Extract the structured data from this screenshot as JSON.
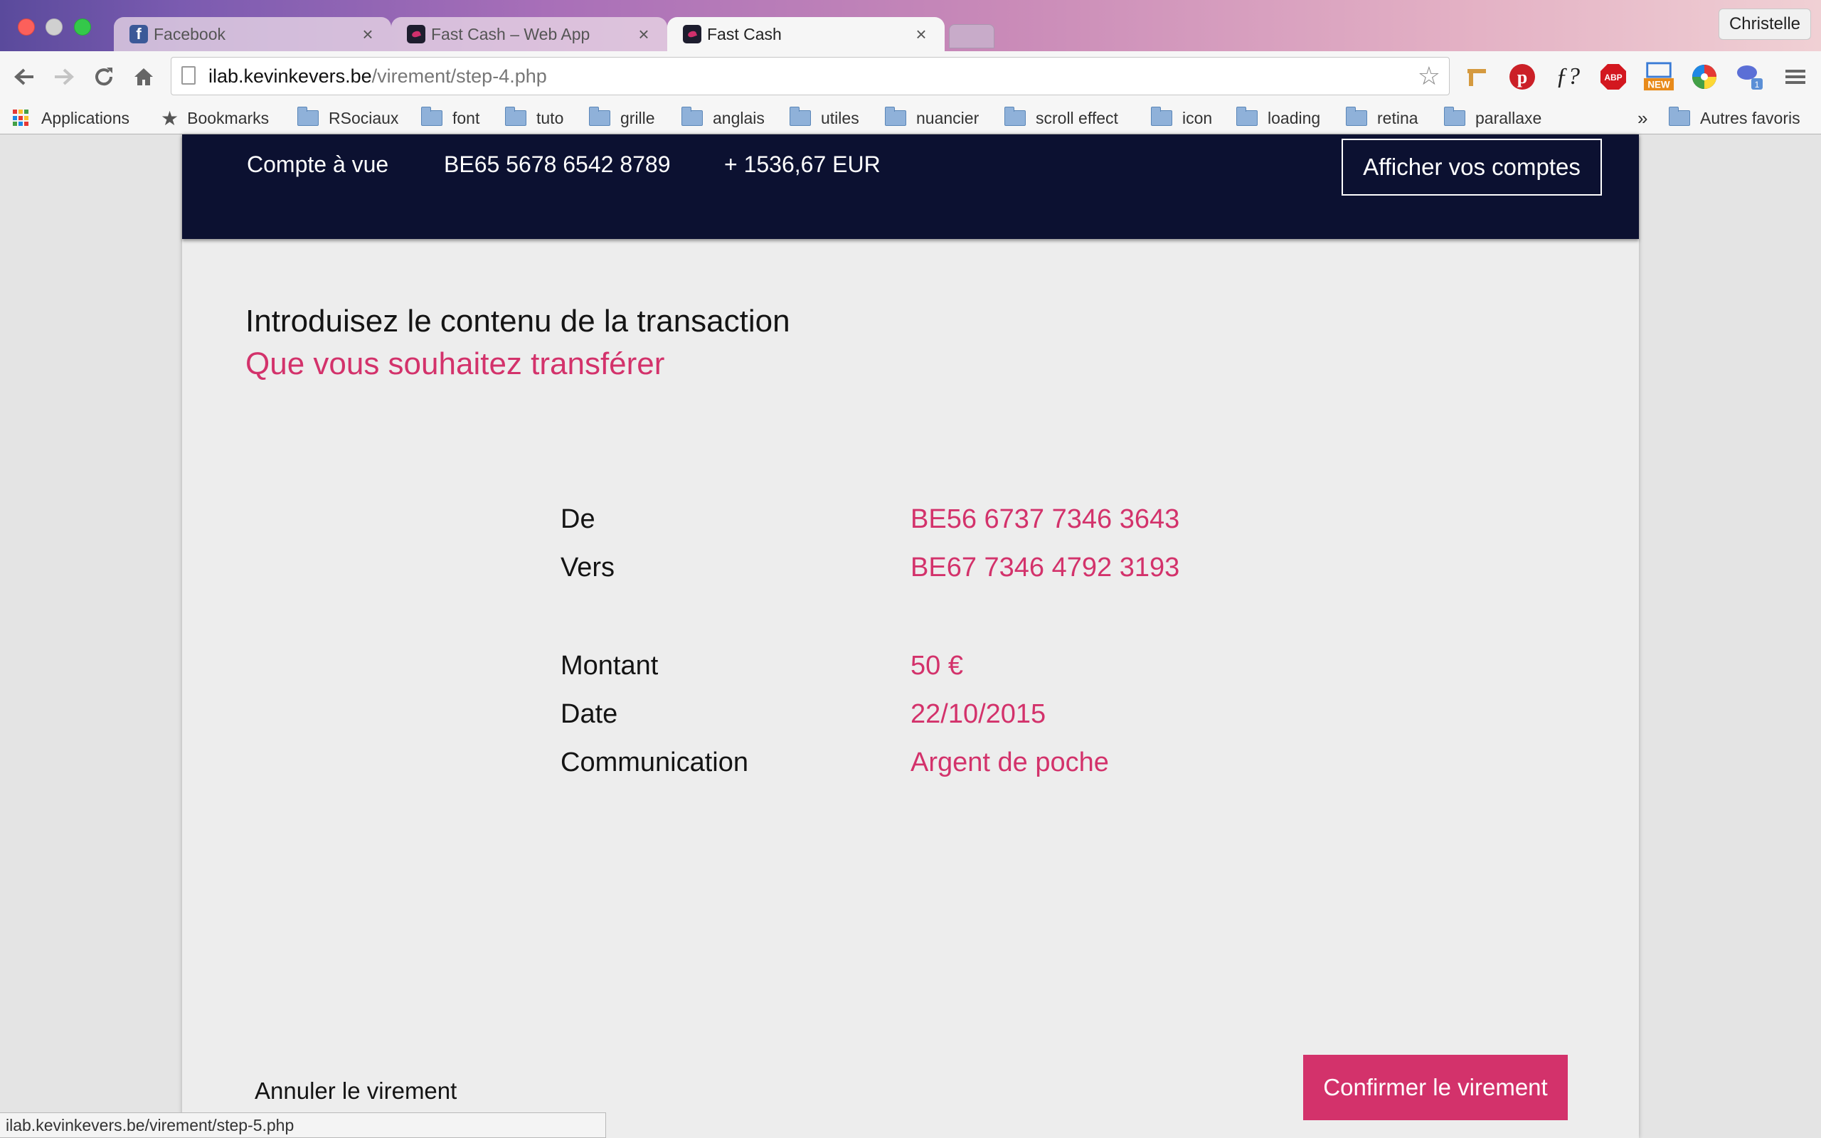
{
  "browser": {
    "tabs": [
      {
        "label": "Facebook",
        "active": false
      },
      {
        "label": "Fast Cash – Web App",
        "active": false
      },
      {
        "label": "Fast Cash",
        "active": true
      }
    ],
    "profile_name": "Christelle",
    "url_host": "ilab.kevinkevers.be",
    "url_path": "/virement/step-4.php",
    "extension_icons": [
      "ruler-icon",
      "pinterest-icon",
      "whatfont-icon",
      "adblock-plus-icon",
      "new-tab-icon",
      "color-wheel-icon",
      "chat-extension-icon",
      "chrome-menu-icon"
    ],
    "extension_badge": "NEW",
    "bookmarks": [
      {
        "label": "Applications",
        "type": "apps"
      },
      {
        "label": "Bookmarks",
        "type": "star"
      },
      {
        "label": "RSociaux",
        "type": "folder"
      },
      {
        "label": "font",
        "type": "folder"
      },
      {
        "label": "tuto",
        "type": "folder"
      },
      {
        "label": "grille",
        "type": "folder"
      },
      {
        "label": "anglais",
        "type": "folder"
      },
      {
        "label": "utiles",
        "type": "folder"
      },
      {
        "label": "nuancier",
        "type": "folder"
      },
      {
        "label": "scroll effect",
        "type": "folder"
      },
      {
        "label": "icon",
        "type": "folder"
      },
      {
        "label": "loading",
        "type": "folder"
      },
      {
        "label": "retina",
        "type": "folder"
      },
      {
        "label": "parallaxe",
        "type": "folder"
      }
    ],
    "bookmarks_overflow": "»",
    "other_bookmarks": "Autres favoris",
    "status_url": "ilab.kevinkevers.be/virement/step-5.php"
  },
  "account_bar": {
    "account_type": "Compte à vue",
    "account_number": "BE65 5678 6542 8789",
    "balance": "+ 1536,67 EUR",
    "show_accounts_label": "Afficher vos comptes"
  },
  "transfer": {
    "title": "Introduisez le contenu de la transaction",
    "subtitle": "Que vous souhaitez transférer",
    "rows": [
      {
        "label": "De",
        "value": "BE56 6737 7346 3643"
      },
      {
        "label": "Vers",
        "value": "BE67 7346 4792 3193"
      },
      {
        "label": "Montant",
        "value": "50 €"
      },
      {
        "label": "Date",
        "value": "22/10/2015"
      },
      {
        "label": "Communication",
        "value": "Argent de poche"
      }
    ],
    "cancel_label": "Annuler le virement",
    "confirm_label": "Confirmer le virement"
  },
  "colors": {
    "accent": "#d3326b",
    "header_bg": "#0c1131",
    "page_bg": "#ededed"
  }
}
